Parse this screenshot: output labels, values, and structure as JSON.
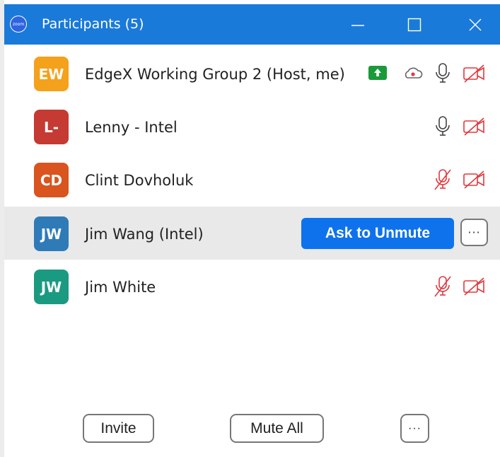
{
  "window": {
    "title": "Participants (5)",
    "logo_text": "zoom",
    "controls": [
      "minimize-icon",
      "maximize-icon",
      "close-icon"
    ],
    "titlebar_color": "#1a7ad9"
  },
  "participants": [
    {
      "initials": "EW",
      "name": "EdgeX Working Group 2 (Host, me)",
      "avatar_color": "#f4a11c",
      "share_icon": "share-screen-icon",
      "record_icon": "cloud-record-icon",
      "mic": "mic-icon",
      "video": "video-off-icon"
    },
    {
      "initials": "L-",
      "name": "Lenny - Intel",
      "avatar_color": "#c53a32",
      "mic": "mic-icon",
      "video": "video-off-icon"
    },
    {
      "initials": "CD",
      "name": "Clint Dovholuk",
      "avatar_color": "#d9541e",
      "mic": "mic-muted-icon",
      "video": "video-off-icon"
    },
    {
      "initials": "JW",
      "name": "Jim Wang (Intel)",
      "avatar_color": "#2f7bb8",
      "action_label": "Ask to Unmute",
      "more_label": "···"
    },
    {
      "initials": "JW",
      "name": "Jim White",
      "avatar_color": "#1b9a82",
      "mic": "mic-muted-icon",
      "video": "video-off-icon"
    }
  ],
  "footer": {
    "invite_label": "Invite",
    "mute_all_label": "Mute All",
    "more_label": "···"
  },
  "colors": {
    "accent": "#0e72ed",
    "muted_red": "#e0393e",
    "hover_row": "#e9e9e9"
  }
}
